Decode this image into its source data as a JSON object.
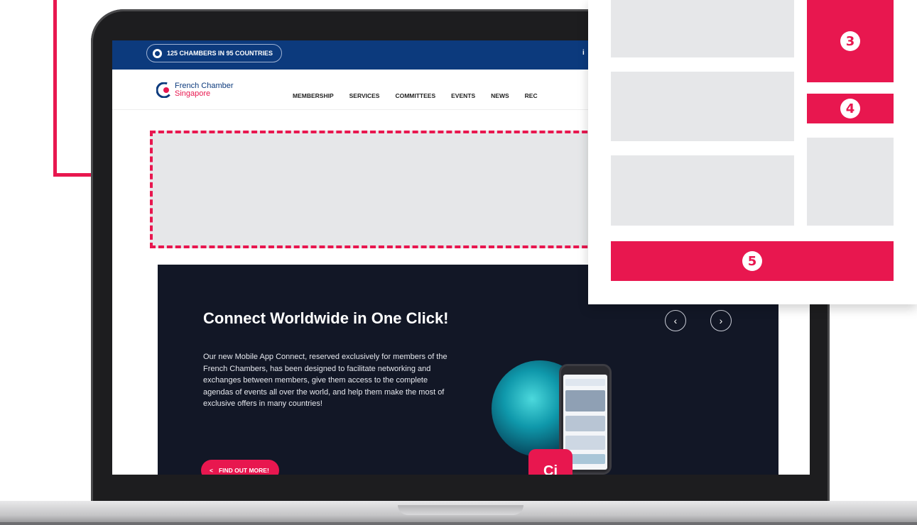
{
  "topbar": {
    "chambers_label": "125 CHAMBERS IN 95 COUNTRIES",
    "right_item": "i"
  },
  "brand": {
    "line1": "French Chamber",
    "line2": "Singapore",
    "logo_text": "Ci"
  },
  "nav": {
    "items": [
      "MEMBERSHIP",
      "SERVICES",
      "COMMITTEES",
      "EVENTS",
      "NEWS",
      "REC"
    ]
  },
  "hero": {
    "title": "Connect Worldwide in One Click!",
    "text": "Our new Mobile App Connect, reserved exclusively for members of the French Chambers, has been designed to facilitate networking and exchanges between members, give them access to the complete agendas of events all over the world, and help them make the most of exclusive offers in many countries!",
    "cta_label": "FIND OUT MORE!",
    "cta_icon": "<",
    "prev_icon": "‹",
    "next_icon": "›",
    "app_icon_text": "Ci"
  },
  "overlay": {
    "badges": [
      "3",
      "4",
      "5"
    ]
  },
  "colors": {
    "accent": "#e8174f",
    "navy": "#0c3a7d",
    "placeholder": "#e6e7e9",
    "hero_bg": "#121726"
  }
}
